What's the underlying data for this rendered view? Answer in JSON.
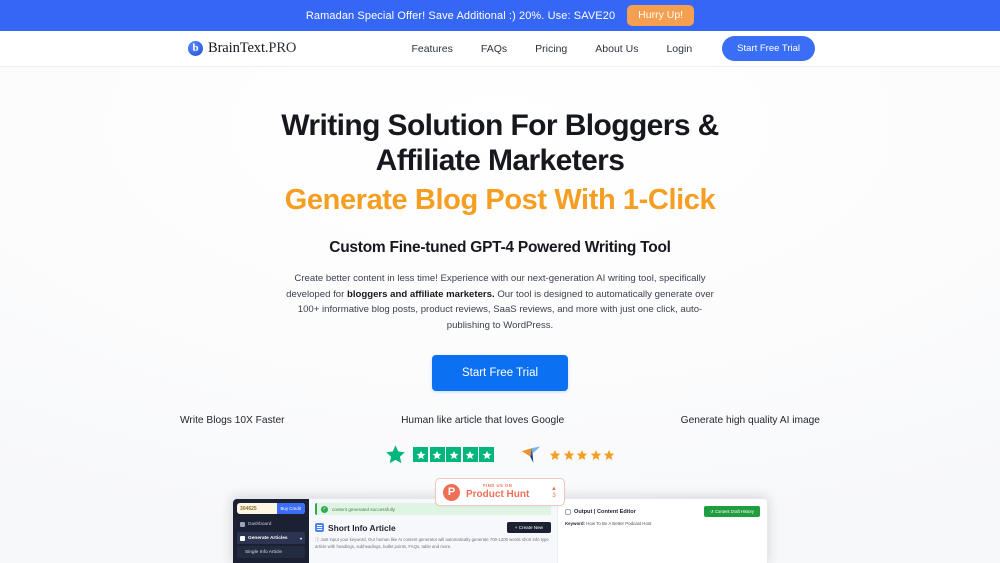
{
  "colors": {
    "brand_blue": "#3566f6",
    "cta_blue": "#0b71f2",
    "accent_orange": "#f59e22",
    "promo_button_orange": "#f5a051",
    "trustpilot_green": "#00b67a",
    "product_hunt_red": "#ef6f56"
  },
  "promo": {
    "text": "Ramadan Special Offer! Save Additional :)  20%. Use: SAVE20",
    "button_label": "Hurry Up!"
  },
  "nav": {
    "brand_mark": "b",
    "brand_name": "BrainText",
    "brand_suffix": ".PRO",
    "links": [
      {
        "label": "Features"
      },
      {
        "label": "FAQs"
      },
      {
        "label": "Pricing"
      },
      {
        "label": "About Us"
      },
      {
        "label": "Login"
      }
    ],
    "cta_label": "Start Free Trial"
  },
  "hero": {
    "title_line1": "Writing Solution For Bloggers &",
    "title_line2": "Affiliate Marketers",
    "title_accent": "Generate Blog Post With 1-Click",
    "subtitle": "Custom Fine-tuned GPT-4 Powered Writing Tool",
    "desc_part1": "Create better content in less time! Experience with our next-generation AI writing tool, specifically developed for ",
    "desc_bold": "bloggers and affiliate marketers.",
    "desc_part2": " Our tool is designed to automatically generate over 100+ informative blog posts, product reviews, SaaS reviews, and more with just one click, auto-publishing to WordPress.",
    "cta_label": "Start Free Trial",
    "features": [
      {
        "label": "Write Blogs 10X Faster"
      },
      {
        "label": "Human like article that loves Google"
      },
      {
        "label": "Generate high quality AI image"
      }
    ]
  },
  "ratings": {
    "trustpilot": {
      "star_count": 5
    },
    "appsumo": {
      "star_count": 5
    }
  },
  "product_hunt": {
    "eyebrow": "FIND US ON",
    "name": "Product Hunt",
    "mark": "P",
    "arrow": "▲",
    "count": "3"
  },
  "app_screenshot": {
    "sidebar": {
      "credits": "304625",
      "buy_credit_label": "Buy Credit",
      "items": [
        {
          "label": "Dashboard"
        },
        {
          "label": "Generate Articles"
        },
        {
          "label": "Single Info Article"
        }
      ]
    },
    "main": {
      "alert": "content generated successfully",
      "card_title": "Short Info Article",
      "create_label": "+ Create New",
      "card_desc": "ⓘ Just input your keyword, Our human like AI content generator will automatically generate 700-1200 words short info type article with headings, subheadings, bullet points, FAQs, table and more."
    },
    "output": {
      "title": "Output | Content Editor",
      "history_label": "↺ Content Draft History",
      "keyword_label": "Keyword:",
      "keyword_value": "How To Be A Better Podcast Host"
    }
  }
}
